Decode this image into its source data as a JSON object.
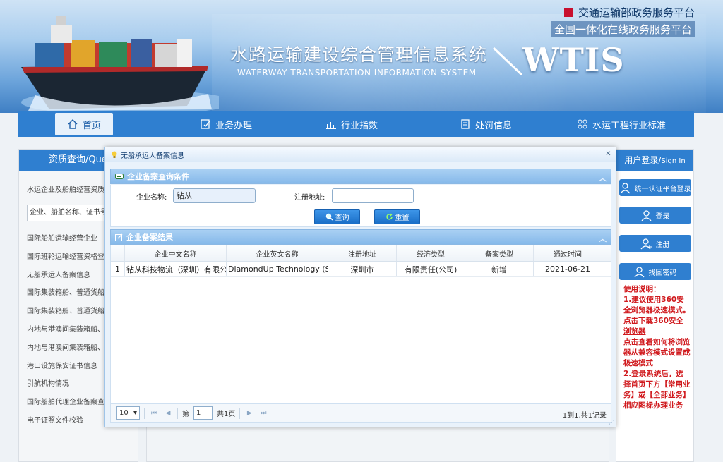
{
  "header": {
    "top_link1": "交通运输部政务服务平台",
    "top_link2": "全国一体化在线政务服务平台",
    "title": "水路运输建设综合管理信息系统",
    "subtitle": "WATERWAY TRANSPORTATION INFORMATION SYSTEM",
    "logo": "WTIS"
  },
  "nav": {
    "items": [
      {
        "label": "首页",
        "icon": "home-icon"
      },
      {
        "label": "业务办理",
        "icon": "edit-icon"
      },
      {
        "label": "行业指数",
        "icon": "bar-chart-icon"
      },
      {
        "label": "处罚信息",
        "icon": "document-icon"
      },
      {
        "label": "水运工程行业标准",
        "icon": "standard-icon"
      }
    ]
  },
  "left_panel": {
    "header": "资质查询/Query",
    "subtitle": "水运企业及船舶经营资质：",
    "select_value": "企业、船舶名称、证书号",
    "items": [
      "国际船舶运输经营企业",
      "国际班轮运输经营资格登记",
      "无船承运人备案信息",
      "国际集装箱船、普通货船运输",
      "国际集装箱船、普通货船运输",
      "内地与港澳间集装箱船、普通货船",
      "内地与港澳间集装箱船、普通货船",
      "港口设施保安证书信息",
      "引航机构情况",
      "国际船舶代理企业备案查询",
      "电子证照文件校验"
    ]
  },
  "right_panel": {
    "header": "用户登录/",
    "header_small": "Sign In",
    "buttons": [
      "统一认证平台登录",
      "登录",
      "注册",
      "找回密码"
    ],
    "usage": {
      "title": "使用说明：",
      "line1": "1.建议使用360安全浏览器极速模式。",
      "link1": "点击下载360安全浏览器",
      "link2": "点击查看如何将浏览器从兼容模式设置成极速模式",
      "line2": "2.登录系统后，选择首页下方【常用业务】或【全部业务】相应图标办理业务"
    }
  },
  "modal": {
    "title": "无船承运人备案信息",
    "query_header": "企业备案查询条件",
    "company_label": "企业名称:",
    "company_value": "钻从",
    "address_label": "注册地址:",
    "address_value": "",
    "search_btn": "查询",
    "reset_btn": "重置",
    "result_header": "企业备案结果",
    "columns": [
      "企业中文名称",
      "企业英文名称",
      "注册地址",
      "经济类型",
      "备案类型",
      "通过时间"
    ],
    "rows": [
      {
        "idx": "1",
        "cn": "钻从科技物流（深圳）有限公司",
        "en": "DiamondUp Technology (SHENZHEN)",
        "addr": "深圳市",
        "type": "有限责任(公司)",
        "rec": "新增",
        "date": "2021-06-21"
      }
    ],
    "pager": {
      "page_size": "10",
      "page_prefix": "第",
      "page_value": "1",
      "page_suffix": "共1页",
      "info": "1到1,共1记录"
    }
  }
}
